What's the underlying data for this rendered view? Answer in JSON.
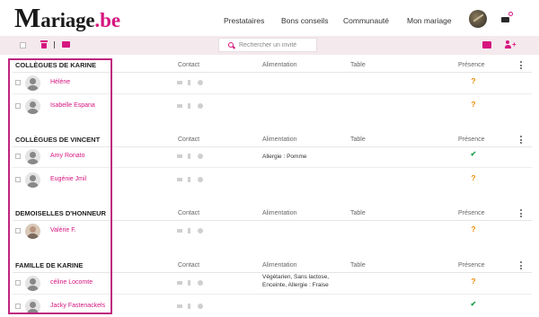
{
  "header": {
    "logo": {
      "m": "M",
      "rest": "ariage",
      "be": ".be"
    },
    "nav": [
      "Prestataires",
      "Bons conseils",
      "Communauté",
      "Mon mariage"
    ],
    "mail_badge": "0"
  },
  "toolbar": {
    "search_placeholder": "Rechercher un invité"
  },
  "columns": {
    "contact": "Contact",
    "alimentation": "Alimentation",
    "table": "Table",
    "presence": "Présence"
  },
  "colors": {
    "accent": "#d6167f",
    "question": "#f08a00",
    "confirmed": "#19a04a"
  },
  "groups": [
    {
      "name": "COLLÈGUES DE KARINE",
      "guests": [
        {
          "name": "Hélène",
          "diet": "",
          "presence": "?",
          "avatar": "placeholder"
        },
        {
          "name": "Isabelle Espana",
          "diet": "",
          "presence": "?",
          "avatar": "placeholder"
        }
      ]
    },
    {
      "name": "COLLÈGUES DE VINCENT",
      "guests": [
        {
          "name": "Amy Ronato",
          "diet": "Allergie : Pomme",
          "presence": "✔",
          "avatar": "placeholder"
        },
        {
          "name": "Eugénie Jmil",
          "diet": "",
          "presence": "?",
          "avatar": "placeholder"
        }
      ]
    },
    {
      "name": "DEMOISELLES D'HONNEUR",
      "guests": [
        {
          "name": "Valérie F.",
          "diet": "",
          "presence": "?",
          "avatar": "photo"
        }
      ]
    },
    {
      "name": "FAMILLE DE KARINE",
      "guests": [
        {
          "name": "céline  Locomte",
          "diet": "Végétarien, Sans lactose,\nEnceinte, Allergie : Fraise",
          "presence": "?",
          "avatar": "placeholder"
        },
        {
          "name": "Jacky Fastenackels",
          "diet": "",
          "presence": "✔",
          "avatar": "placeholder"
        }
      ]
    }
  ]
}
